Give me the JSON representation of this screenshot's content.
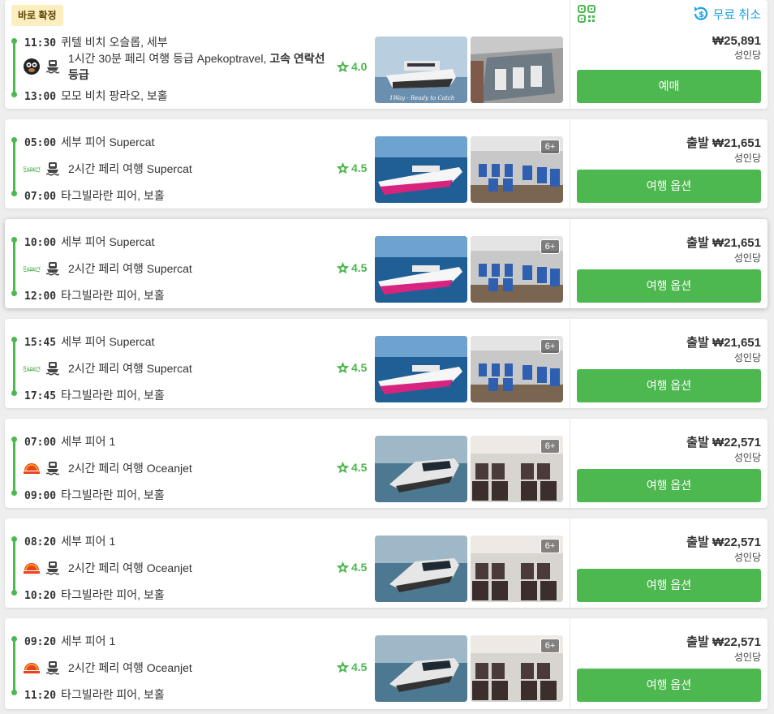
{
  "cards": [
    {
      "badge": "바로 확정",
      "dep_time": "11:30",
      "dep_place": "퀴텔 비치 오슬롭, 세부",
      "trip": "1시간 30분 페리 여행 등급 Apekoptravel, ",
      "trip_bold": "고속 연락선 등급",
      "arr_time": "13:00",
      "arr_place": "모모 비치 팡라오, 보홀",
      "rating": "4.0",
      "operator": "apeko-monkey-logo",
      "price_label": "",
      "price": "₩25,891",
      "per": "성인당",
      "button": "예매",
      "cancel": "무료 취소",
      "photo_caption": "1Way - Ready to Catch",
      "photo_count": ""
    },
    {
      "dep_time": "05:00",
      "dep_place": "세부 피어 Supercat",
      "trip": "2시간 페리 여행 Supercat",
      "arr_time": "07:00",
      "arr_place": "타그빌라란 피어, 보홀",
      "rating": "4.5",
      "operator": "supercat-logo",
      "price_label": "출발 ",
      "price": "₩21,651",
      "per": "성인당",
      "button": "여행 옵션",
      "photo_count": "6+"
    },
    {
      "dep_time": "10:00",
      "dep_place": "세부 피어 Supercat",
      "trip": "2시간 페리 여행 Supercat",
      "arr_time": "12:00",
      "arr_place": "타그빌라란 피어, 보홀",
      "rating": "4.5",
      "operator": "supercat-logo",
      "price_label": "출발 ",
      "price": "₩21,651",
      "per": "성인당",
      "button": "여행 옵션",
      "photo_count": "6+"
    },
    {
      "dep_time": "15:45",
      "dep_place": "세부 피어 Supercat",
      "trip": "2시간 페리 여행 Supercat",
      "arr_time": "17:45",
      "arr_place": "타그빌라란 피어, 보홀",
      "rating": "4.5",
      "operator": "supercat-logo",
      "price_label": "출발 ",
      "price": "₩21,651",
      "per": "성인당",
      "button": "여행 옵션",
      "photo_count": "6+"
    },
    {
      "dep_time": "07:00",
      "dep_place": "세부 피어 1",
      "trip": "2시간 페리 여행 Oceanjet",
      "arr_time": "09:00",
      "arr_place": "타그빌라란 피어, 보홀",
      "rating": "4.5",
      "operator": "oceanjet-logo",
      "price_label": "출발 ",
      "price": "₩22,571",
      "per": "성인당",
      "button": "여행 옵션",
      "photo_count": "6+"
    },
    {
      "dep_time": "08:20",
      "dep_place": "세부 피어 1",
      "trip": "2시간 페리 여행 Oceanjet",
      "arr_time": "10:20",
      "arr_place": "타그빌라란 피어, 보홀",
      "rating": "4.5",
      "operator": "oceanjet-logo",
      "price_label": "출발 ",
      "price": "₩22,571",
      "per": "성인당",
      "button": "여행 옵션",
      "photo_count": "6+"
    },
    {
      "dep_time": "09:20",
      "dep_place": "세부 피어 1",
      "trip": "2시간 페리 여행 Oceanjet",
      "arr_time": "11:20",
      "arr_place": "타그빌라란 피어, 보홀",
      "rating": "4.5",
      "operator": "oceanjet-logo",
      "price_label": "출발 ",
      "price": "₩22,571",
      "per": "성인당",
      "button": "여행 옵션",
      "photo_count": "6+"
    }
  ],
  "colors": {
    "accent": "#4cb84f",
    "cancel": "#1ba3e0",
    "badge_bg": "#fdeec0"
  }
}
